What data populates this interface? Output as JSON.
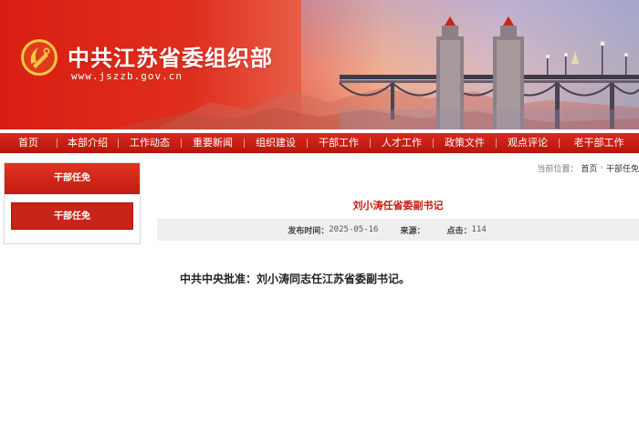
{
  "header": {
    "title": "中共江苏省委组织部",
    "url": "www.jszzb.gov.cn",
    "emblem_icon": "party-emblem-icon",
    "brand_color": "#d81e12"
  },
  "nav": {
    "items": [
      {
        "label": "首页"
      },
      {
        "label": "本部介绍"
      },
      {
        "label": "工作动态"
      },
      {
        "label": "重要新闻"
      },
      {
        "label": "组织建设"
      },
      {
        "label": "干部工作"
      },
      {
        "label": "人才工作"
      },
      {
        "label": "政策文件"
      },
      {
        "label": "观点评论"
      },
      {
        "label": "老干部工作"
      }
    ]
  },
  "sidebar": {
    "heading": "干部任免",
    "items": [
      {
        "label": "干部任免"
      }
    ]
  },
  "breadcrumb": {
    "prefix": "当前位置：",
    "home": "首页",
    "separator_icon": "chevron-right-icon",
    "current": "干部任免"
  },
  "article": {
    "title": "刘小涛任省委副书记",
    "meta": {
      "date_label": "发布时间：",
      "date": "2025-05-16",
      "source_label": "来源：",
      "source": "",
      "clicks_label": "点击：",
      "clicks": "114"
    },
    "body_lead": "中共中央批准：",
    "body_text": "刘小涛同志任江苏省委副书记。"
  }
}
